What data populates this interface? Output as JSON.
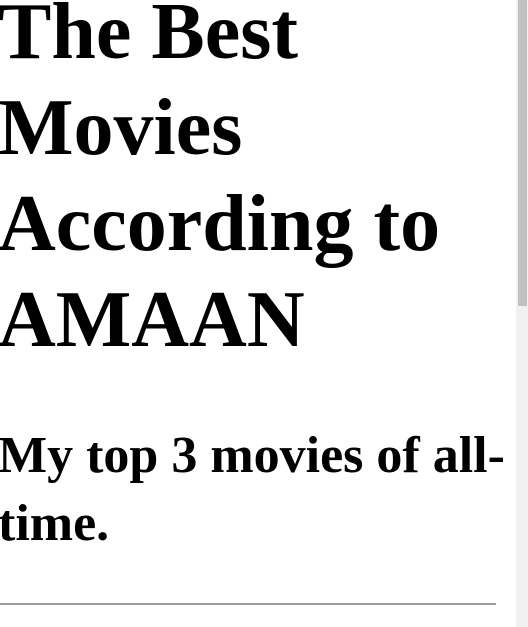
{
  "page": {
    "title": "The Best Movies According to AMAAN",
    "subtitle": "My top 3 movies of all-time."
  }
}
